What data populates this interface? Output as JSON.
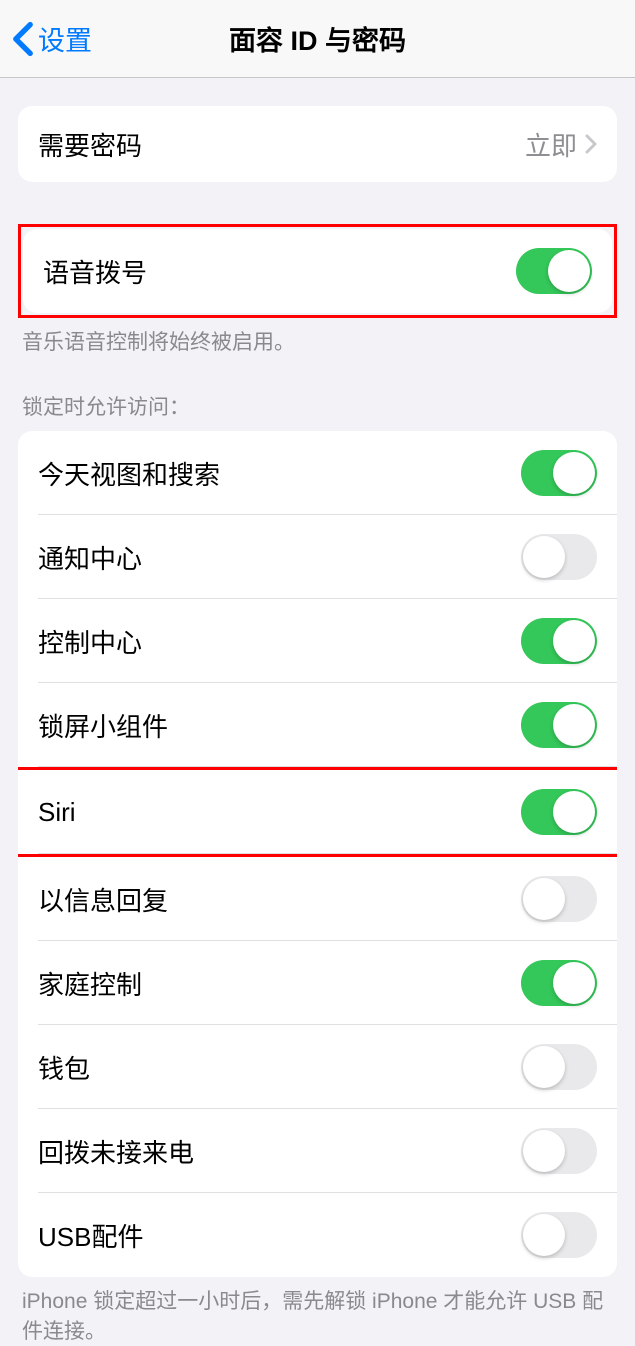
{
  "nav": {
    "back_label": "设置",
    "title": "面容 ID 与密码"
  },
  "require_passcode": {
    "label": "需要密码",
    "value": "立即"
  },
  "voice_dial": {
    "label": "语音拨号",
    "on": true,
    "footer": "音乐语音控制将始终被启用。"
  },
  "locked_access": {
    "header": "锁定时允许访问：",
    "items": [
      {
        "label": "今天视图和搜索",
        "on": true
      },
      {
        "label": "通知中心",
        "on": false
      },
      {
        "label": "控制中心",
        "on": true
      },
      {
        "label": "锁屏小组件",
        "on": true
      },
      {
        "label": "Siri",
        "on": true
      },
      {
        "label": "以信息回复",
        "on": false
      },
      {
        "label": "家庭控制",
        "on": true
      },
      {
        "label": "钱包",
        "on": false
      },
      {
        "label": "回拨未接来电",
        "on": false
      },
      {
        "label": "USB配件",
        "on": false
      }
    ],
    "footer": "iPhone 锁定超过一小时后，需先解锁 iPhone 才能允许 USB 配件连接。"
  }
}
